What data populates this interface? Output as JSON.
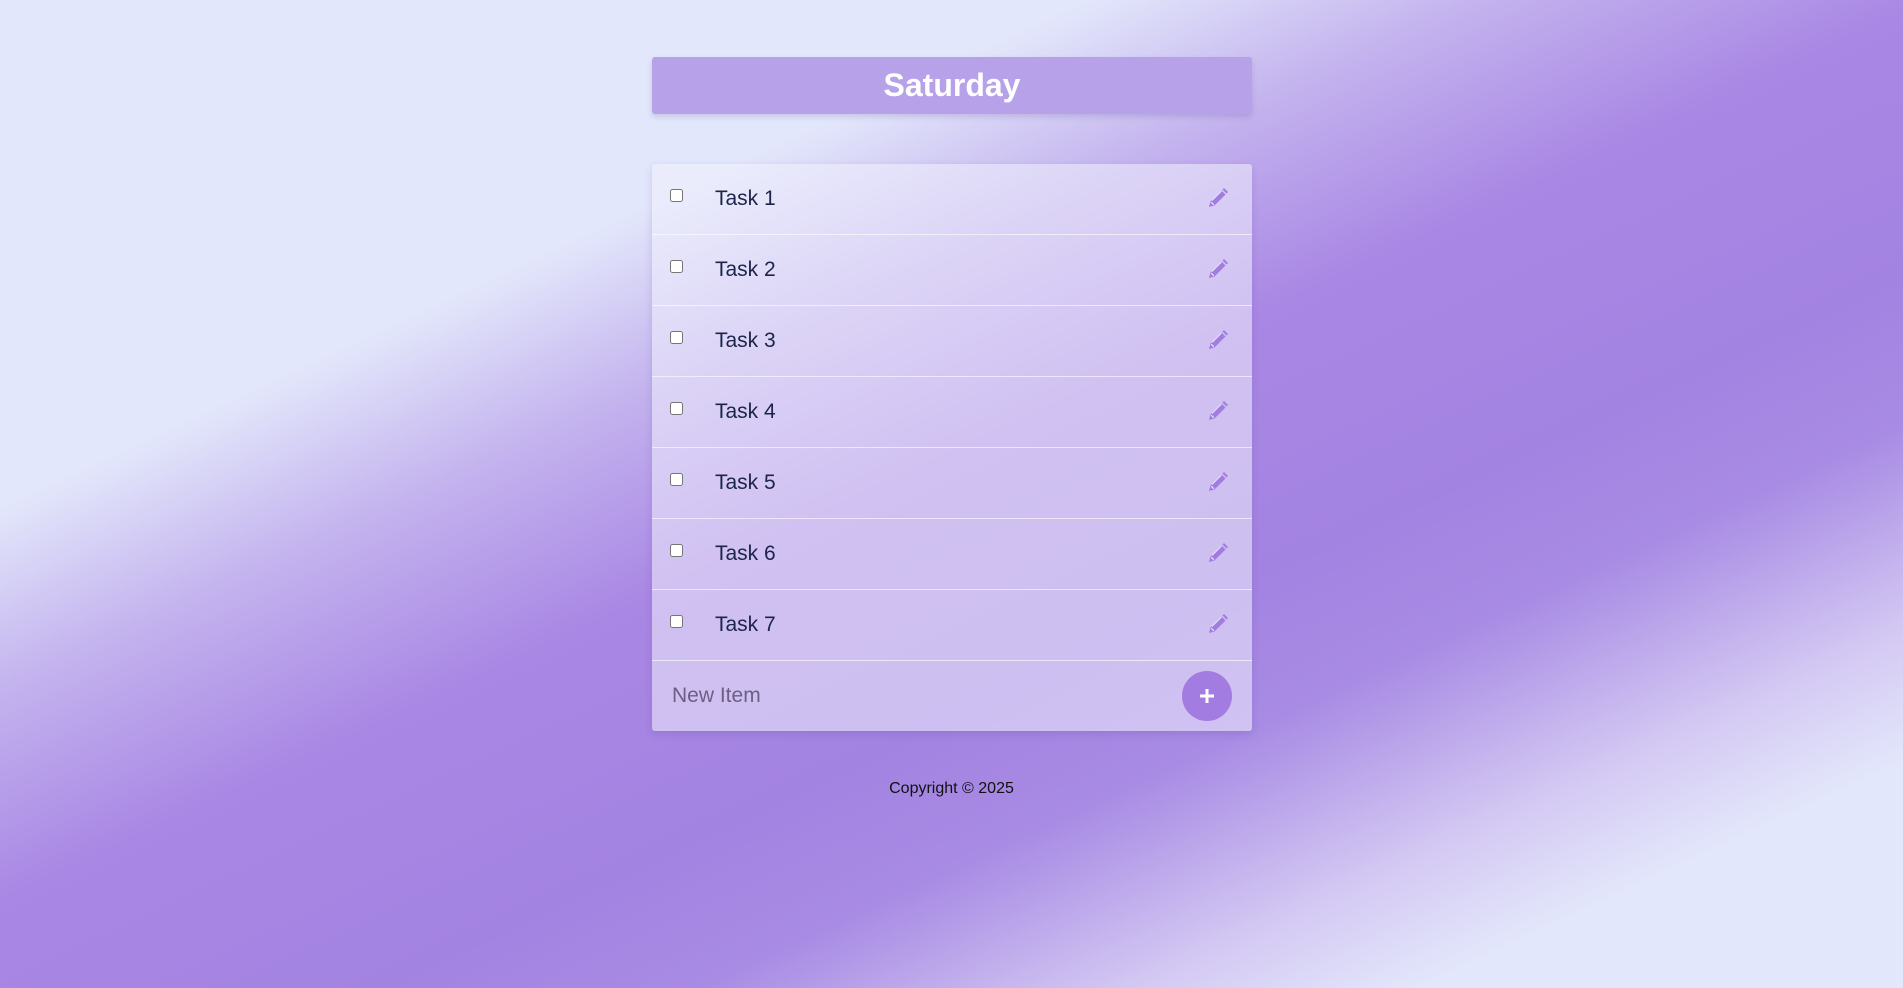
{
  "header": {
    "title": "Saturday"
  },
  "tasks": [
    {
      "label": "Task 1",
      "checked": false
    },
    {
      "label": "Task 2",
      "checked": false
    },
    {
      "label": "Task 3",
      "checked": false
    },
    {
      "label": "Task 4",
      "checked": false
    },
    {
      "label": "Task 5",
      "checked": false
    },
    {
      "label": "Task 6",
      "checked": false
    },
    {
      "label": "Task 7",
      "checked": false
    }
  ],
  "new_item": {
    "placeholder": "New Item",
    "value": ""
  },
  "footer": {
    "copyright": "Copyright © 2025"
  },
  "icons": {
    "edit": "pencil-icon",
    "add": "plus-icon"
  },
  "colors": {
    "accent": "#a27ce0",
    "header_bg": "#b7a2ea",
    "text": "#1c2449"
  }
}
